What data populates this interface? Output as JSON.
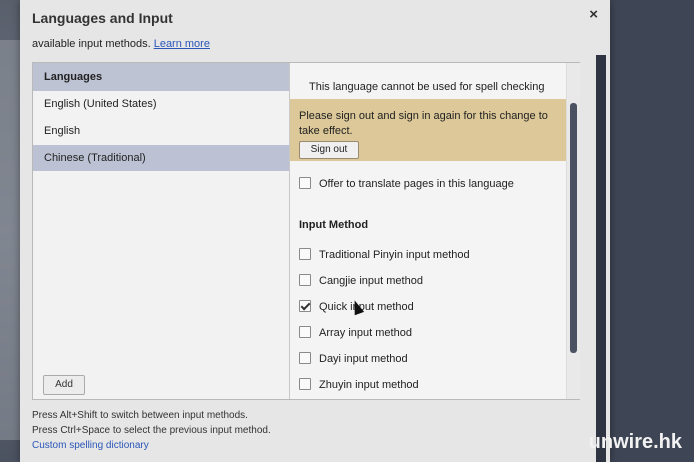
{
  "dialog": {
    "title": "Languages and Input",
    "close_glyph": "×",
    "subtitle_prefix": "available input methods.",
    "learn_more": "Learn more"
  },
  "languages": {
    "header": "Languages",
    "items": [
      {
        "label": "English (United States)",
        "selected": false
      },
      {
        "label": "English",
        "selected": false
      },
      {
        "label": "Chinese (Traditional)",
        "selected": true
      }
    ],
    "add_label": "Add"
  },
  "settings": {
    "spellcheck_text": "This language cannot be used for spell checking",
    "notice_text": "Please sign out and sign in again for this change to take effect.",
    "signout_label": "Sign out",
    "offer_translate": {
      "label": "Offer to translate pages in this language",
      "checked": false
    },
    "input_method_header": "Input Method",
    "input_methods": [
      {
        "label": "Traditional Pinyin input method",
        "checked": false
      },
      {
        "label": "Cangjie input method",
        "checked": false
      },
      {
        "label": "Quick input method",
        "checked": true
      },
      {
        "label": "Array input method",
        "checked": false
      },
      {
        "label": "Dayi input method",
        "checked": false
      },
      {
        "label": "Zhuyin input method",
        "checked": false
      }
    ]
  },
  "footer": {
    "line1": "Press Alt+Shift to switch between input methods.",
    "line2": "Press Ctrl+Space to select the previous input method.",
    "link": "Custom spelling dictionary"
  },
  "watermark": "unwire.hk",
  "colors": {
    "selected_row": "#bcc2d3",
    "notice_bg": "#dcc898",
    "link": "#2a56b8"
  }
}
